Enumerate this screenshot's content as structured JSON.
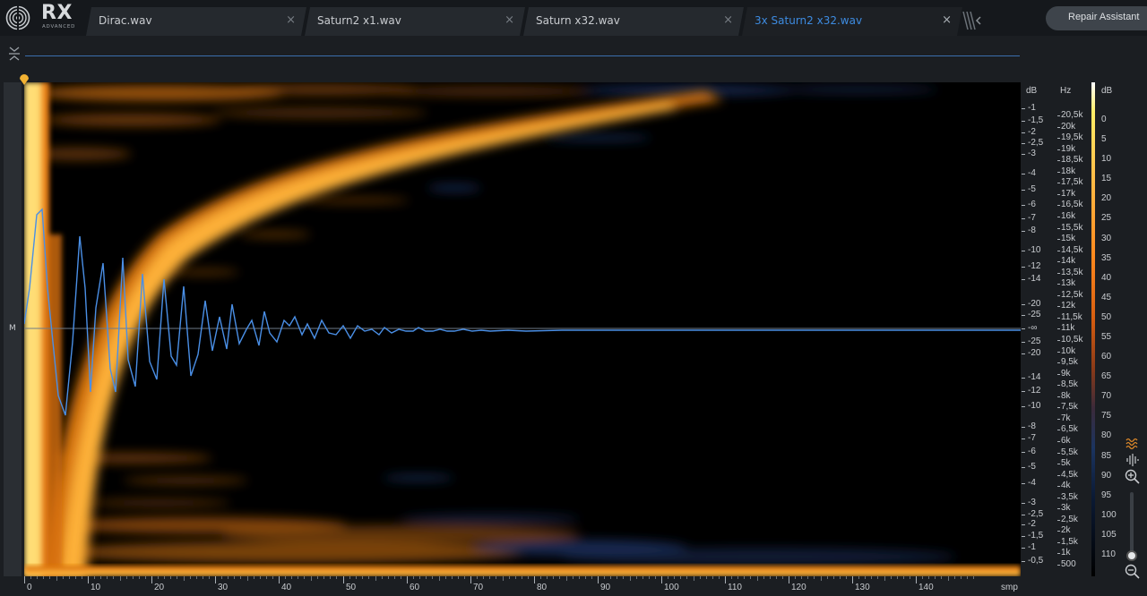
{
  "app": {
    "logo_text": "RX",
    "logo_sub": "ADVANCED"
  },
  "tabs": [
    {
      "label": "Dirac.wav",
      "active": false
    },
    {
      "label": "Saturn2 x1.wav",
      "active": false
    },
    {
      "label": "Saturn x32.wav",
      "active": false
    },
    {
      "label": "3x Saturn2 x32.wav",
      "active": true
    }
  ],
  "tab_close_glyph": "×",
  "repair_button": "Repair Assistant",
  "channel_label": "M",
  "colors": {
    "accent": "#3d8be0",
    "waveform": "#4a8fe6",
    "spectro_hot": "#ffb33a",
    "spectro_warm": "#e07a10",
    "spectro_cool": "#1e3a6e"
  },
  "db_axis": {
    "header": "dB",
    "upper": [
      "-1",
      "-1,5",
      "-2",
      "-2,5",
      "-3",
      "-4",
      "-5",
      "-6",
      "-7",
      "-8",
      "-10",
      "-12",
      "-14",
      "-20",
      "-25"
    ],
    "center": "-∞",
    "lower": [
      "-25",
      "-20",
      "-14",
      "-12",
      "-10",
      "-8",
      "-7",
      "-6",
      "-5",
      "-4",
      "-3",
      "-2,5",
      "-2",
      "-1,5",
      "-1",
      "-0,5"
    ]
  },
  "hz_axis": {
    "header": "Hz",
    "labels": [
      "20,5k",
      "20k",
      "19,5k",
      "19k",
      "18,5k",
      "18k",
      "17,5k",
      "17k",
      "16,5k",
      "16k",
      "15,5k",
      "15k",
      "14,5k",
      "14k",
      "13,5k",
      "13k",
      "12,5k",
      "12k",
      "11,5k",
      "11k",
      "10,5k",
      "10k",
      "9,5k",
      "9k",
      "8,5k",
      "8k",
      "7,5k",
      "7k",
      "6,5k",
      "6k",
      "5,5k",
      "5k",
      "4,5k",
      "4k",
      "3,5k",
      "3k",
      "2,5k",
      "2k",
      "1,5k",
      "1k",
      "500"
    ]
  },
  "colorbar_axis": {
    "header": "dB",
    "labels": [
      "0",
      "5",
      "10",
      "15",
      "20",
      "25",
      "30",
      "35",
      "40",
      "45",
      "50",
      "55",
      "60",
      "65",
      "70",
      "75",
      "80",
      "85",
      "90",
      "95",
      "100",
      "105",
      "110"
    ]
  },
  "time_axis": {
    "labels": [
      "0",
      "10",
      "20",
      "30",
      "40",
      "50",
      "60",
      "70",
      "80",
      "90",
      "100",
      "110",
      "120",
      "130",
      "140"
    ],
    "unit": "smp"
  },
  "tools": [
    "spectrogram-mode-icon",
    "waveform-mode-icon",
    "zoom-in-icon",
    "zoom-out-icon"
  ]
}
